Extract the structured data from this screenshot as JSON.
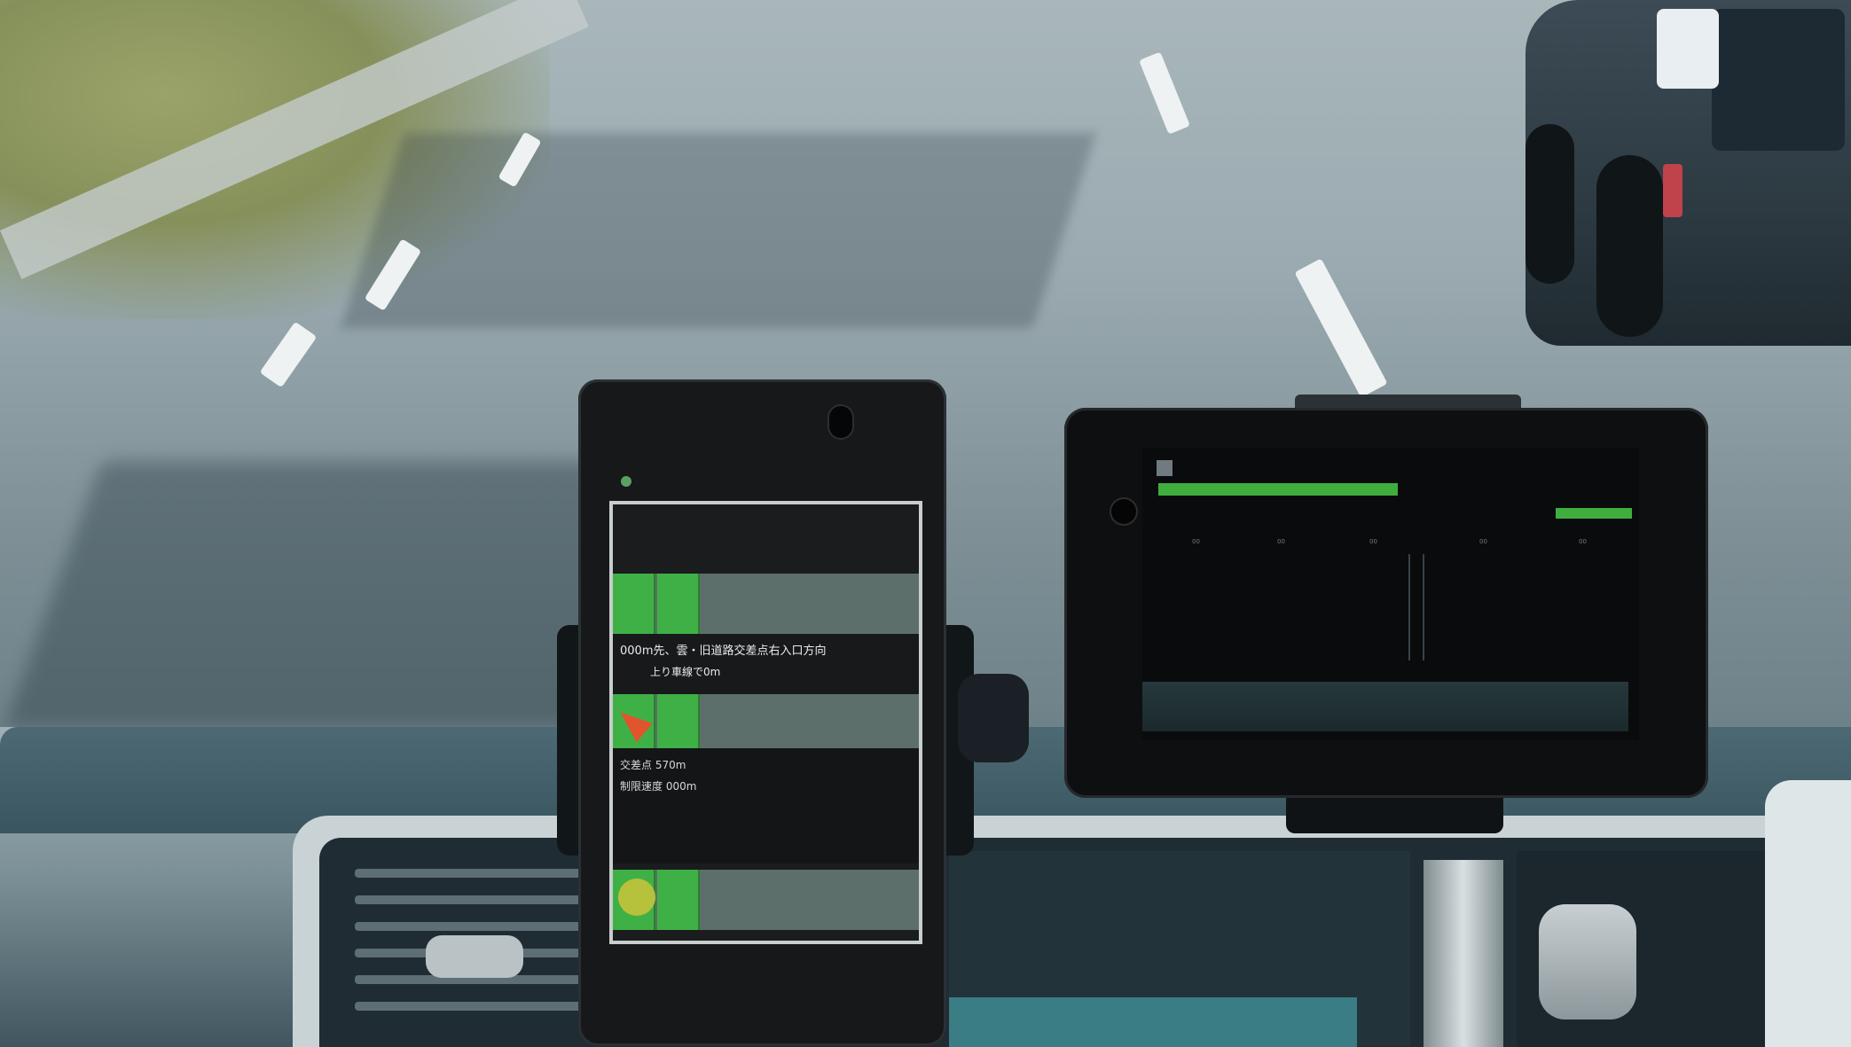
{
  "phone_app": {
    "status_title": "",
    "header_line1": "",
    "header_line2": "",
    "header_line3": "",
    "guidance_line1": "000m先、雲・旧道路交差点右入口方向",
    "guidance_line2": "上り車線で0m",
    "info_line1": "交差点 570m",
    "info_line2": "制限速度 000m"
  },
  "tablet_app": {
    "title": "",
    "header_right": "",
    "subheader": "",
    "ticks": [
      "00",
      "00",
      "00",
      "00",
      "00"
    ]
  },
  "colors": {
    "lane_green": "#3fb046",
    "arrow_orange": "#e0542e",
    "circle_yellow": "#b6c23c",
    "tablet_bar_green": "#3fae3e"
  },
  "icons": [
    "navigation-arrow-icon",
    "signal-circle-icon",
    "app-icon"
  ]
}
